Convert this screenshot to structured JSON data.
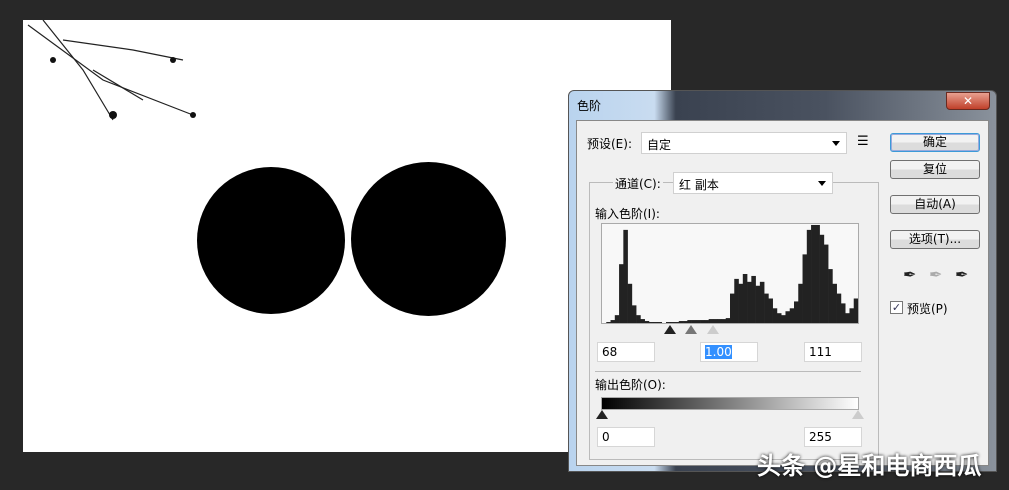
{
  "dialog": {
    "title": "色阶",
    "close": "✕",
    "preset_label": "预设(E):",
    "preset_value": "自定",
    "preset_menu_icon": "list-menu-icon",
    "channel_label": "通道(C):",
    "channel_value": "红 副本",
    "input_levels_label": "输入色阶(I):",
    "input_black": "68",
    "input_gamma": "1.00",
    "input_white": "111",
    "output_levels_label": "输出色阶(O):",
    "output_black": "0",
    "output_white": "255",
    "buttons": {
      "ok": "确定",
      "reset": "复位",
      "auto": "自动(A)",
      "options": "选项(T)..."
    },
    "preview_label": "预览(P)",
    "preview_checked": true
  },
  "histogram": [
    0,
    1,
    3,
    8,
    60,
    95,
    40,
    18,
    8,
    4,
    2,
    1,
    1,
    1,
    0,
    1,
    1,
    1,
    2,
    2,
    3,
    3,
    3,
    3,
    3,
    4,
    4,
    4,
    4,
    5,
    30,
    45,
    40,
    50,
    42,
    48,
    38,
    42,
    30,
    25,
    15,
    10,
    8,
    12,
    15,
    22,
    40,
    70,
    95,
    100,
    100,
    90,
    80,
    55,
    40,
    30,
    20,
    10,
    15,
    25
  ],
  "watermark": "头条 @星和电商西瓜"
}
